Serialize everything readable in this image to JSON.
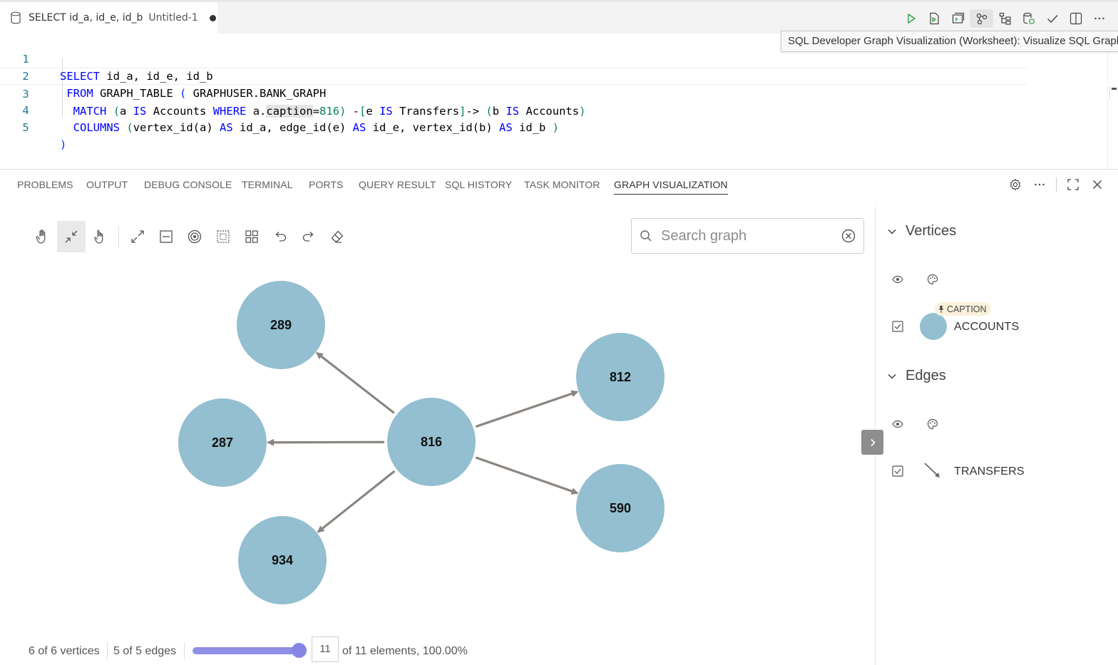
{
  "editor_tab": {
    "title": "SELECT id_a, id_e, id_b",
    "description": "Untitled-1"
  },
  "tooltip": "SQL Developer Graph Visualization (Worksheet): Visualize SQL Graph",
  "toolbar_icons": [
    "run-icon",
    "run-script-icon",
    "run-in-terminal-icon",
    "graph-visualize-icon",
    "explain-plan-icon",
    "database-icon",
    "commit-icon",
    "split-editor-icon",
    "more-icon"
  ],
  "editor": {
    "line_numbers": [
      "1",
      "2",
      "3",
      "4",
      "5"
    ],
    "lines": [
      "SELECT id_a, id_e, id_b",
      " FROM GRAPH_TABLE ( GRAPHUSER.BANK_GRAPH",
      "  MATCH (a IS Accounts WHERE a.caption=816) -[e IS Transfers]-> (b IS Accounts)",
      "  COLUMNS (vertex_id(a) AS id_a, edge_id(e) AS id_e, vertex_id(b) AS id_b )",
      ")"
    ],
    "highlighted_word": "caption"
  },
  "panel_tabs": [
    "PROBLEMS",
    "OUTPUT",
    "DEBUG CONSOLE",
    "TERMINAL",
    "PORTS",
    "QUERY RESULT",
    "SQL HISTORY",
    "TASK MONITOR",
    "GRAPH VISUALIZATION"
  ],
  "active_panel_tab": "GRAPH VISUALIZATION",
  "search": {
    "placeholder": "Search graph",
    "value": ""
  },
  "graph": {
    "center": "816",
    "vertices": [
      "816",
      "289",
      "287",
      "934",
      "812",
      "590"
    ],
    "edges": [
      {
        "from": "816",
        "to": "289"
      },
      {
        "from": "816",
        "to": "287"
      },
      {
        "from": "816",
        "to": "934"
      },
      {
        "from": "816",
        "to": "812"
      },
      {
        "from": "816",
        "to": "590"
      }
    ],
    "node_color": "#93bfd0",
    "edge_color": "#8a8580"
  },
  "footer": {
    "vertices_text": "6 of 6 vertices",
    "edges_text": "5 of 5 edges",
    "element_count": "11",
    "elements_text": "of 11 elements, 100.00%",
    "slider_fraction": 1.0
  },
  "right_panel": {
    "vertices_heading": "Vertices",
    "vertex_caption_badge": "CAPTION",
    "vertex_label": "ACCOUNTS",
    "edges_heading": "Edges",
    "edge_label": "TRANSFERS"
  }
}
